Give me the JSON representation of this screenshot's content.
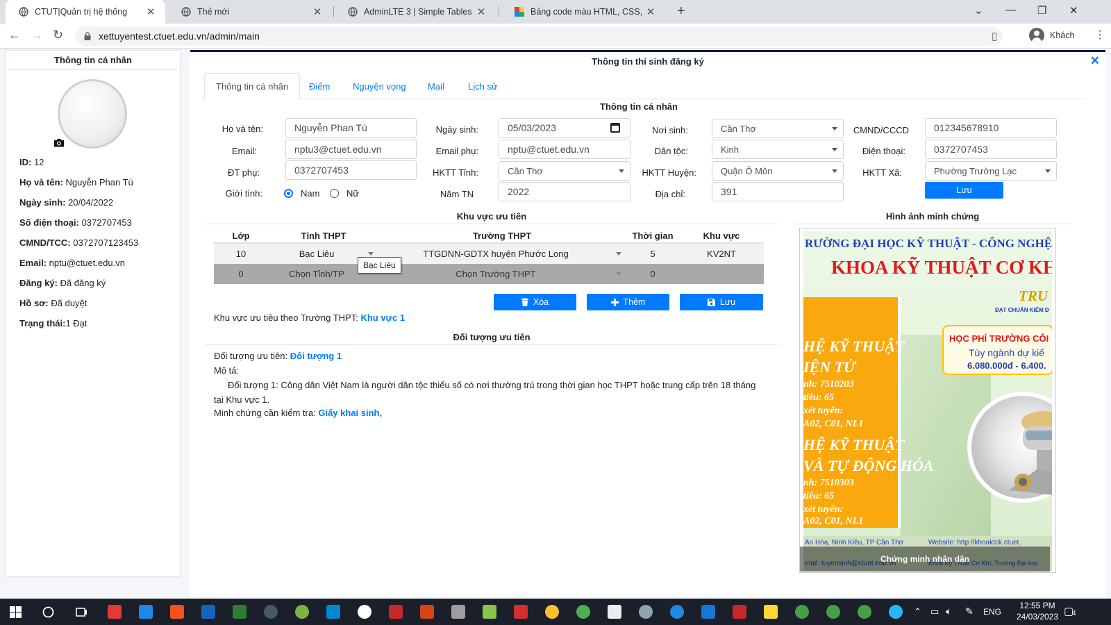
{
  "browser": {
    "tabs": [
      {
        "title": "CTUT|Quản trị hệ thống",
        "active": true
      },
      {
        "title": "Thẻ mới",
        "active": false
      },
      {
        "title": "AdminLTE 3 | Simple Tables",
        "active": false
      },
      {
        "title": "Bảng code màu HTML, CSS, RGB",
        "active": false
      }
    ],
    "url": "xettuyentest.ctuet.edu.vn/admin/main",
    "profile_label": "Khách"
  },
  "left": {
    "title": "Thông tin cá nhân",
    "rows": [
      {
        "label": "ID:",
        "value": " 12"
      },
      {
        "label": "Họ và tên:",
        "value": " Nguyễn Phan Tú"
      },
      {
        "label": "Ngày sinh:",
        "value": " 20/04/2022"
      },
      {
        "label": "Số điện thoại:",
        "value": " 0372707453"
      },
      {
        "label": "CMND/TCC:",
        "value": " 0372707123453"
      },
      {
        "label": "Email:",
        "value": " nptu@ctuet.edu.vn"
      },
      {
        "label": "Đăng ký:",
        "value": " Đã đăng ký"
      },
      {
        "label": "Hồ sơ:",
        "value": " Đã duyệt"
      },
      {
        "label": "Trạng thái:",
        "value": "1 Đạt"
      }
    ]
  },
  "main": {
    "title": "Thông tin thí sinh đăng ký",
    "tabs": [
      "Thông tin cá nhân",
      "Điểm",
      "Nguyện vọng",
      "Mail",
      "Lịch sử"
    ],
    "personal": {
      "heading": "Thông tin cá nhân",
      "labels": {
        "ho_ten": "Họ và tên:",
        "ngay_sinh": "Ngày sinh:",
        "noi_sinh": "Nơi sinh:",
        "cmnd": "CMND/CCCD",
        "email": "Email:",
        "email_phu": "Email phụ:",
        "dan_toc": "Dân tộc:",
        "dien_thoai": "Điện thoại:",
        "dt_phu": "ĐT phụ:",
        "hktt_tinh": "HKTT Tỉnh:",
        "hktt_huyen": "HKTT Huyện:",
        "hktt_xa": "HKTT Xã:",
        "gioi_tinh": "Giới tính:",
        "nam_tn": "Năm TN",
        "dia_chi": "Địa chỉ:"
      },
      "values": {
        "ho_ten": "Nguyễn Phan Tú",
        "ngay_sinh": "05/03/2023",
        "noi_sinh": "Cần Thơ",
        "cmnd": "012345678910",
        "email": "nptu3@ctuet.edu.vn",
        "email_phu": "nptu@ctuet.edu.vn",
        "dan_toc": "Kinh",
        "dien_thoai": "0372707453",
        "dt_phu": "0372707453",
        "hktt_tinh": "Cần Thơ",
        "hktt_huyen": "Quận Ô Môn",
        "hktt_xa": "Phường Trường Lạc",
        "nam_tn": "2022",
        "dia_chi": "391"
      },
      "gender_options": [
        "Nam",
        "Nữ"
      ],
      "gender_selected": "Nam",
      "save_label": "Lưu"
    },
    "priority_area": {
      "heading": "Khu vực ưu tiên",
      "columns": [
        "Lớp",
        "Tỉnh THPT",
        "Trường THPT",
        "Thời gian",
        "Khu vực"
      ],
      "rows": [
        [
          "10",
          "Bạc Liêu",
          "TTGDNN-GDTX huyện Phước Long",
          "5",
          "KV2NT"
        ],
        [
          "0",
          "Chọn Tỉnh/TP",
          "Chọn Trường THPT",
          "0",
          ""
        ]
      ],
      "tooltip": "Bạc Liêu",
      "buttons": {
        "delete": "Xóa",
        "add": "Thêm",
        "save": "Lưu"
      },
      "result_label": "Khu vực ưu tiêu theo Trường THPT:",
      "result_value": "Khu vực 1"
    },
    "priority_subject": {
      "heading": "Đối tượng ưu tiên",
      "subject_label": "Đối tượng ưu tiên:",
      "subject_value": "Đối tượng 1",
      "desc_label": "Mô tả:",
      "description": "Đối tượng 1: Công dân Việt Nam là người dân tộc thiểu số có nơi thường trú trong thời gian học THPT hoặc trung cấp trên 18 tháng tại Khu vực 1.",
      "proof_label": "Minh chứng cần kiểm tra:",
      "proof_value": "Giấy khai sinh,"
    },
    "evidence": {
      "heading": "Hình ảnh minh chứng",
      "caption": "Chứng minh nhân dân",
      "poster": {
        "line1": "RƯỜNG ĐẠI HỌC KỸ THUẬT - CÔNG NGHỆ CẦN",
        "line2": "KHOA KỸ THUẬT CƠ KHÍ",
        "truy": "TRU",
        "dat_chuan": "ĐẠT CHUẨN KIỂM Đ",
        "box_a": "HỌC PHÍ TRƯỜNG CÔI",
        "box_b": "Tùy ngành dự kiế",
        "box_c": "6.080.000đ - 6.400.",
        "o1": "HỆ KỸ THUẬT",
        "o2": "IỆN TỬ",
        "o3": "nh: 7510203",
        "o4": "tiêu: 65",
        "o5": "xét tuyển:",
        "o6": "A02, C01, NL1",
        "o7": "HỆ KỸ THUẬT",
        "o8": "VÀ TỰ ĐỘNG HÓA",
        "o9": "nh: 7510303",
        "o10": "tiêu: 65",
        "o11": "xét tuyển:",
        "o12": "A02, C01, NL1",
        "foot1": "An Hòa, Ninh Kiều, TP Cần Thơ",
        "foot2": "Website: http://khoaktck.ctuet.",
        "foot3": "mail: tuyensinh@ctuet.edu.vn",
        "foot4": "Khoa Kỹ Thuật Cơ Khí, Trường Đại học"
      }
    }
  },
  "taskbar": {
    "lang": "ENG",
    "time": "12:55 PM",
    "date": "24/03/2023",
    "notif_count": "4"
  }
}
